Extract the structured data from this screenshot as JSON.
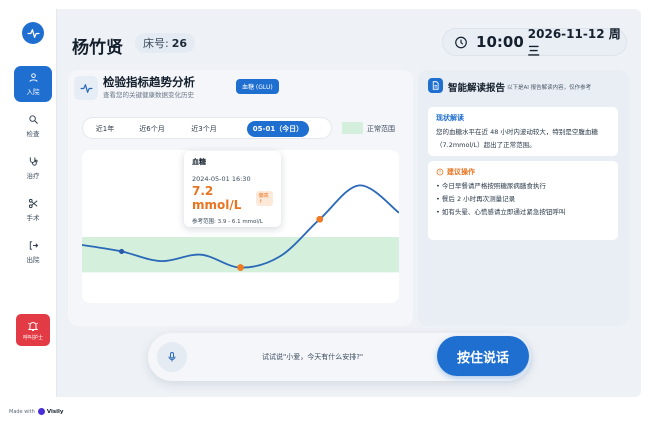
{
  "header": {
    "patient_name": "杨竹贤",
    "bed_label": "床号:",
    "bed_number": "26",
    "time": "10:00",
    "date": "2026-11-12 周三"
  },
  "sidebar": {
    "items": [
      {
        "label": "入院",
        "icon": "user-icon",
        "active": true
      },
      {
        "label": "检查",
        "icon": "search-icon",
        "active": false
      },
      {
        "label": "治疗",
        "icon": "stethoscope-icon",
        "active": false
      },
      {
        "label": "手术",
        "icon": "scissors-icon",
        "active": false
      },
      {
        "label": "出院",
        "icon": "logout-icon",
        "active": false
      }
    ],
    "nurse_call_label": "呼叫护士"
  },
  "trend": {
    "title": "检验指标趋势分析",
    "subtitle": "查看您的关键健康数据变化历史",
    "indicator_badge": "血糖 (GLU)",
    "ranges": [
      "近1年",
      "近6个月",
      "近3个月",
      "05-01（今日）"
    ],
    "active_range": 3,
    "legend_label": "正常范围"
  },
  "tooltip": {
    "title": "血糖",
    "time": "2024-05-01 16:30",
    "value": "7.2 mmol/L",
    "flag": "偏高↑",
    "reference": "参考范围: 3.9 - 6.1 mmol/L"
  },
  "chart_data": {
    "type": "line",
    "title": "",
    "xlabel": "",
    "ylabel": "",
    "normal_range": [
      3.9,
      6.1
    ],
    "ylim": [
      2.0,
      11.0
    ],
    "series": [
      {
        "values": [
          5.6,
          5.2,
          4.6,
          5.0,
          4.2,
          4.9,
          7.2,
          9.3,
          7.6
        ]
      }
    ],
    "highlighted_points": [
      {
        "index": 1,
        "value": 5.2,
        "color": "#2a5aa8"
      },
      {
        "index": 4,
        "value": 4.2,
        "color": "#f07a24"
      },
      {
        "index": 6,
        "value": 7.2,
        "color": "#f07a24"
      }
    ],
    "line_color": "#2a68b8",
    "normal_color": "#d4f0dc"
  },
  "report": {
    "title": "智能解读报告",
    "subtitle": "以下是AI 报告解读内容，仅作参考",
    "summary_heading": "现状解读",
    "summary_text": "您的血糖水平在近 48 小时内波动较大，特别是空腹血糖（7.2mmol/L）超出了正常范围。",
    "advice_heading": "建议操作",
    "advice_items": [
      "今日早餐请严格按照糖尿病膳食执行",
      "餐后 2 小时再次测量记录",
      "如有头晕、心慌感请立即通过紧急按钮呼叫"
    ]
  },
  "voice": {
    "hint": "试试说\"小爱，今天有什么安排?\"",
    "talk_button": "按住说话"
  },
  "footer": {
    "made_with": "Made with",
    "brand": "Visily"
  },
  "colors": {
    "primary": "#1f6fd1",
    "warning": "#e87421",
    "danger": "#e23b45"
  }
}
